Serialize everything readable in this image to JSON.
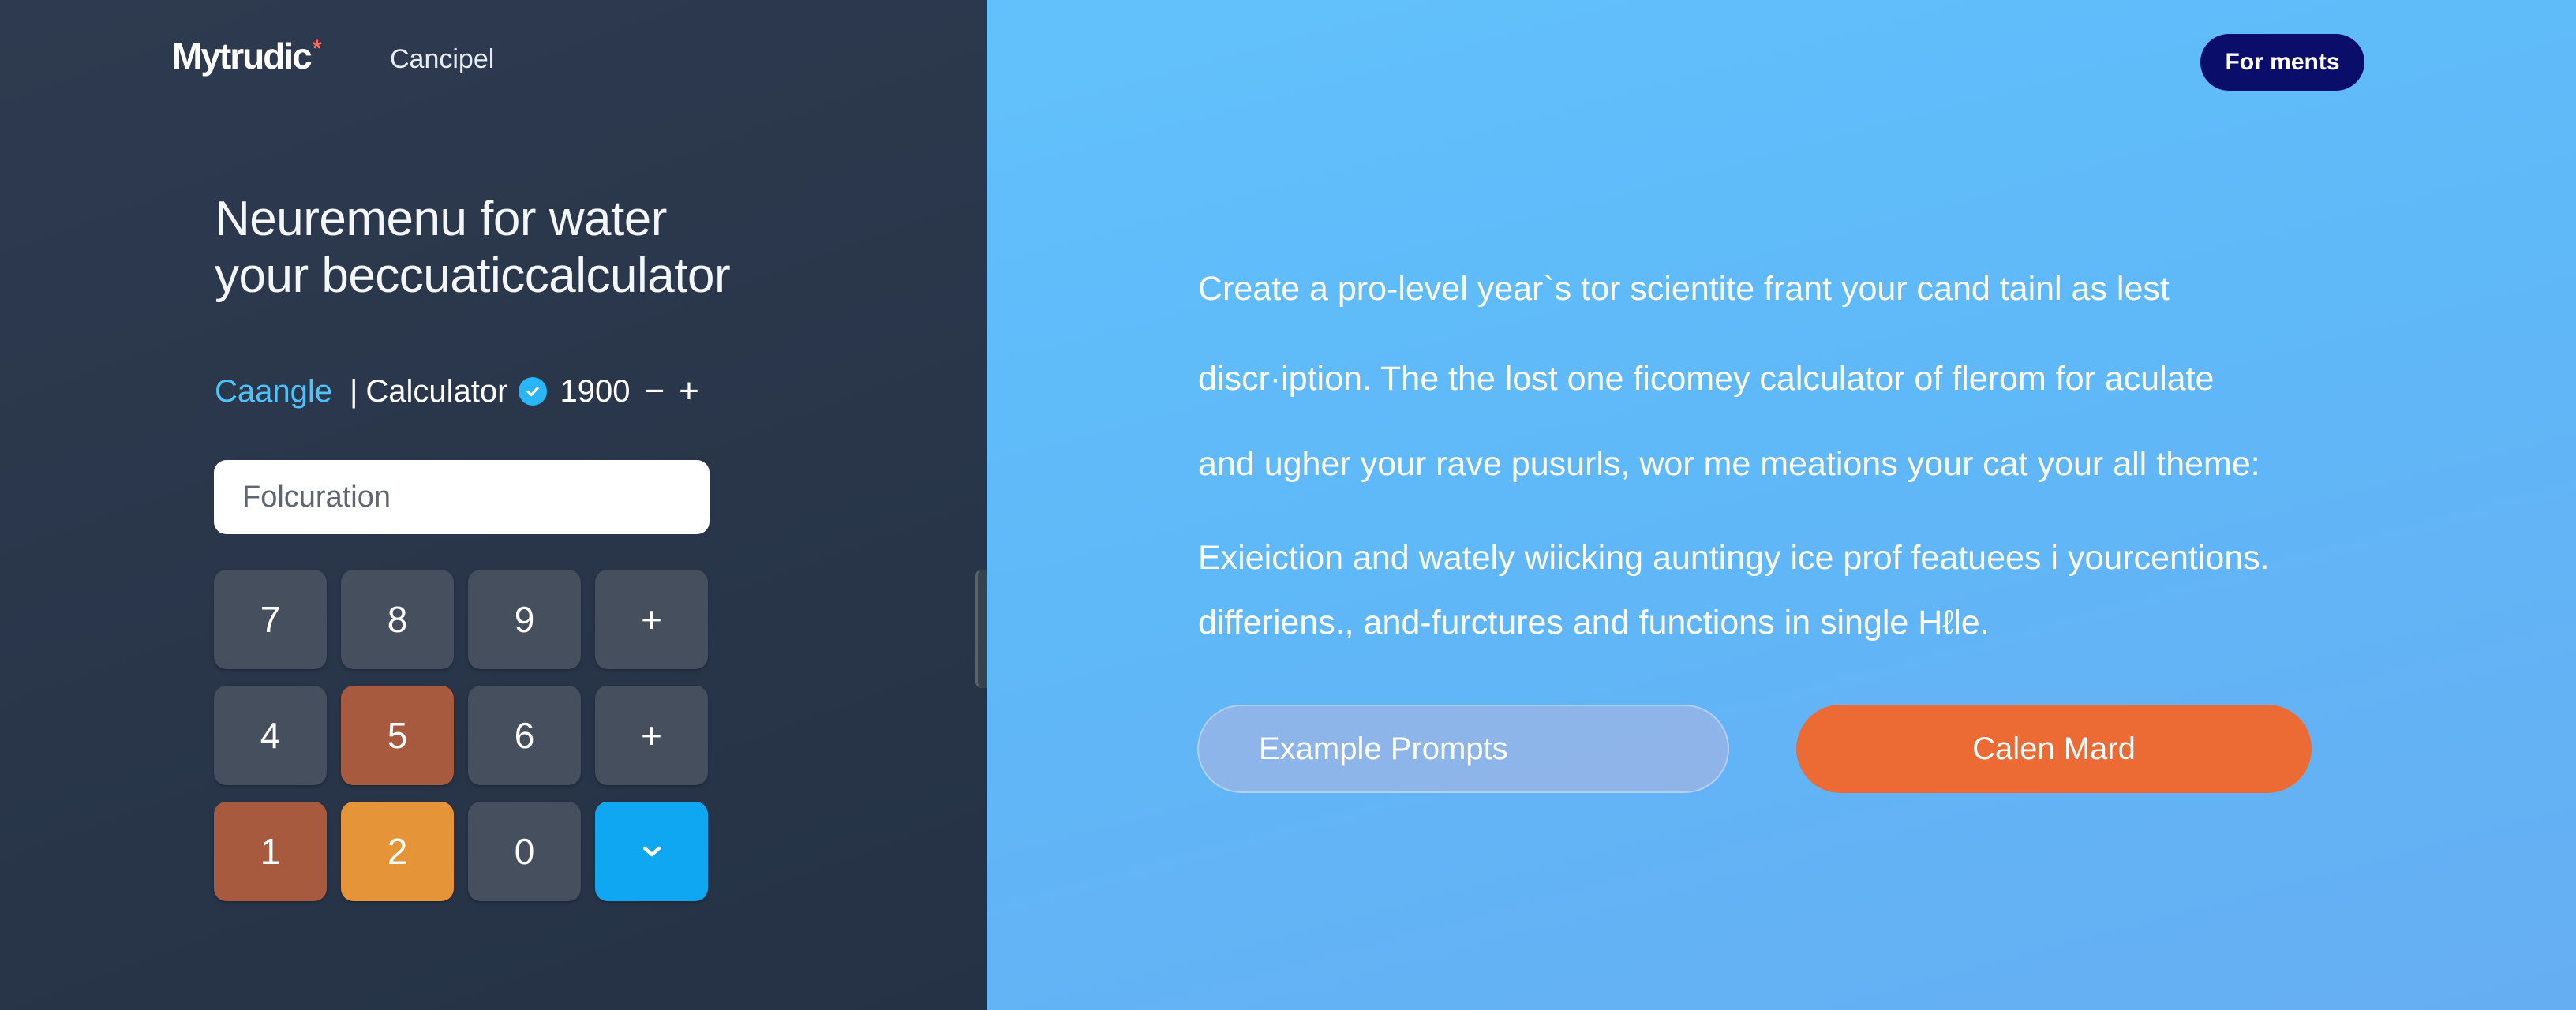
{
  "colors": {
    "left_bg": "#2b374b",
    "right_bg": "#5fb8f8",
    "accent_cyan": "#4fc3f7",
    "pill_navy": "#0b0d6b",
    "primary_orange": "#ec6a33",
    "key_gray": "#454f5d",
    "key_rust": "#a85a3f",
    "key_orange": "#e59438",
    "key_blue": "#10a7f2"
  },
  "header": {
    "brand": "Mytrudic",
    "brand_mark": "*",
    "nav_link": "Cancipel",
    "pill_button": "For ments"
  },
  "left": {
    "headline_line1": "Neuremenu for water",
    "headline_line2": "your beccuaticcalculator",
    "subrow": {
      "tag": "Caangle",
      "separator": "|",
      "calc_label": "Calculator",
      "badge_icon": "check-circle-icon",
      "number": "1900",
      "minus": "−",
      "plus": "+"
    },
    "input": {
      "placeholder": "Folcuration",
      "value": ""
    },
    "keypad": [
      {
        "label": "7",
        "style": "gray"
      },
      {
        "label": "8",
        "style": "gray"
      },
      {
        "label": "9",
        "style": "gray"
      },
      {
        "label": "+",
        "style": "gray"
      },
      {
        "label": "4",
        "style": "gray"
      },
      {
        "label": "5",
        "style": "rust"
      },
      {
        "label": "6",
        "style": "gray"
      },
      {
        "label": "+",
        "style": "gray"
      },
      {
        "label": "1",
        "style": "rust"
      },
      {
        "label": "2",
        "style": "orange"
      },
      {
        "label": "0",
        "style": "gray"
      },
      {
        "label": "",
        "style": "blue",
        "icon": "check-icon"
      }
    ]
  },
  "right": {
    "para_lines": [
      "Create a pro-level year`s tor scientite frant your cand tainl as lest",
      "discr·iption.   The the lost one ficomey calculator of flerom for aculate",
      "and ugher your rave pusurls, wor me meations your cat your all theme:",
      "Exieiction and watelу wiicking auntingy ice prof featuees i yourcentions.",
      "differiens., and-furctures and functions in single Hℓle."
    ],
    "buttons": {
      "ghost": "Example Prompts",
      "primary": "Calen Mard"
    }
  }
}
